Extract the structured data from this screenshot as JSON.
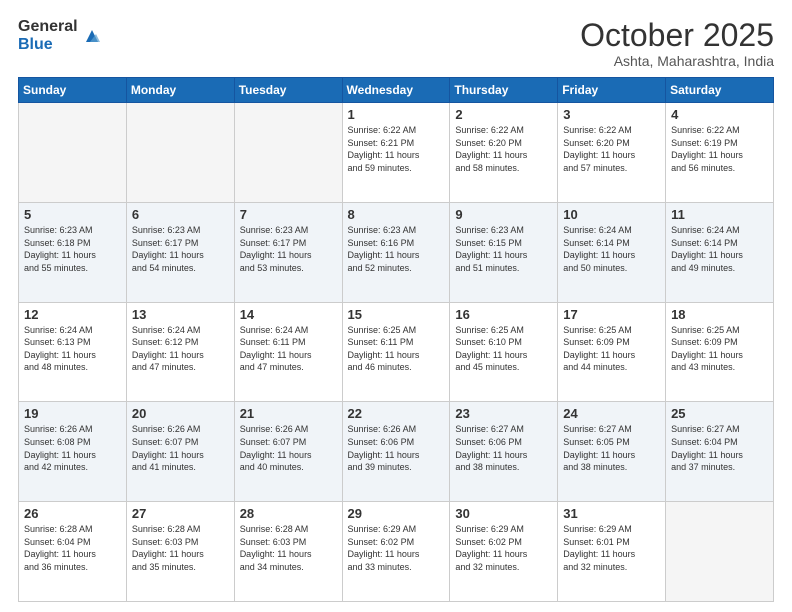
{
  "logo": {
    "general": "General",
    "blue": "Blue"
  },
  "header": {
    "month": "October 2025",
    "location": "Ashta, Maharashtra, India"
  },
  "weekdays": [
    "Sunday",
    "Monday",
    "Tuesday",
    "Wednesday",
    "Thursday",
    "Friday",
    "Saturday"
  ],
  "weeks": [
    [
      {
        "day": "",
        "info": ""
      },
      {
        "day": "",
        "info": ""
      },
      {
        "day": "",
        "info": ""
      },
      {
        "day": "1",
        "info": "Sunrise: 6:22 AM\nSunset: 6:21 PM\nDaylight: 11 hours\nand 59 minutes."
      },
      {
        "day": "2",
        "info": "Sunrise: 6:22 AM\nSunset: 6:20 PM\nDaylight: 11 hours\nand 58 minutes."
      },
      {
        "day": "3",
        "info": "Sunrise: 6:22 AM\nSunset: 6:20 PM\nDaylight: 11 hours\nand 57 minutes."
      },
      {
        "day": "4",
        "info": "Sunrise: 6:22 AM\nSunset: 6:19 PM\nDaylight: 11 hours\nand 56 minutes."
      }
    ],
    [
      {
        "day": "5",
        "info": "Sunrise: 6:23 AM\nSunset: 6:18 PM\nDaylight: 11 hours\nand 55 minutes."
      },
      {
        "day": "6",
        "info": "Sunrise: 6:23 AM\nSunset: 6:17 PM\nDaylight: 11 hours\nand 54 minutes."
      },
      {
        "day": "7",
        "info": "Sunrise: 6:23 AM\nSunset: 6:17 PM\nDaylight: 11 hours\nand 53 minutes."
      },
      {
        "day": "8",
        "info": "Sunrise: 6:23 AM\nSunset: 6:16 PM\nDaylight: 11 hours\nand 52 minutes."
      },
      {
        "day": "9",
        "info": "Sunrise: 6:23 AM\nSunset: 6:15 PM\nDaylight: 11 hours\nand 51 minutes."
      },
      {
        "day": "10",
        "info": "Sunrise: 6:24 AM\nSunset: 6:14 PM\nDaylight: 11 hours\nand 50 minutes."
      },
      {
        "day": "11",
        "info": "Sunrise: 6:24 AM\nSunset: 6:14 PM\nDaylight: 11 hours\nand 49 minutes."
      }
    ],
    [
      {
        "day": "12",
        "info": "Sunrise: 6:24 AM\nSunset: 6:13 PM\nDaylight: 11 hours\nand 48 minutes."
      },
      {
        "day": "13",
        "info": "Sunrise: 6:24 AM\nSunset: 6:12 PM\nDaylight: 11 hours\nand 47 minutes."
      },
      {
        "day": "14",
        "info": "Sunrise: 6:24 AM\nSunset: 6:11 PM\nDaylight: 11 hours\nand 47 minutes."
      },
      {
        "day": "15",
        "info": "Sunrise: 6:25 AM\nSunset: 6:11 PM\nDaylight: 11 hours\nand 46 minutes."
      },
      {
        "day": "16",
        "info": "Sunrise: 6:25 AM\nSunset: 6:10 PM\nDaylight: 11 hours\nand 45 minutes."
      },
      {
        "day": "17",
        "info": "Sunrise: 6:25 AM\nSunset: 6:09 PM\nDaylight: 11 hours\nand 44 minutes."
      },
      {
        "day": "18",
        "info": "Sunrise: 6:25 AM\nSunset: 6:09 PM\nDaylight: 11 hours\nand 43 minutes."
      }
    ],
    [
      {
        "day": "19",
        "info": "Sunrise: 6:26 AM\nSunset: 6:08 PM\nDaylight: 11 hours\nand 42 minutes."
      },
      {
        "day": "20",
        "info": "Sunrise: 6:26 AM\nSunset: 6:07 PM\nDaylight: 11 hours\nand 41 minutes."
      },
      {
        "day": "21",
        "info": "Sunrise: 6:26 AM\nSunset: 6:07 PM\nDaylight: 11 hours\nand 40 minutes."
      },
      {
        "day": "22",
        "info": "Sunrise: 6:26 AM\nSunset: 6:06 PM\nDaylight: 11 hours\nand 39 minutes."
      },
      {
        "day": "23",
        "info": "Sunrise: 6:27 AM\nSunset: 6:06 PM\nDaylight: 11 hours\nand 38 minutes."
      },
      {
        "day": "24",
        "info": "Sunrise: 6:27 AM\nSunset: 6:05 PM\nDaylight: 11 hours\nand 38 minutes."
      },
      {
        "day": "25",
        "info": "Sunrise: 6:27 AM\nSunset: 6:04 PM\nDaylight: 11 hours\nand 37 minutes."
      }
    ],
    [
      {
        "day": "26",
        "info": "Sunrise: 6:28 AM\nSunset: 6:04 PM\nDaylight: 11 hours\nand 36 minutes."
      },
      {
        "day": "27",
        "info": "Sunrise: 6:28 AM\nSunset: 6:03 PM\nDaylight: 11 hours\nand 35 minutes."
      },
      {
        "day": "28",
        "info": "Sunrise: 6:28 AM\nSunset: 6:03 PM\nDaylight: 11 hours\nand 34 minutes."
      },
      {
        "day": "29",
        "info": "Sunrise: 6:29 AM\nSunset: 6:02 PM\nDaylight: 11 hours\nand 33 minutes."
      },
      {
        "day": "30",
        "info": "Sunrise: 6:29 AM\nSunset: 6:02 PM\nDaylight: 11 hours\nand 32 minutes."
      },
      {
        "day": "31",
        "info": "Sunrise: 6:29 AM\nSunset: 6:01 PM\nDaylight: 11 hours\nand 32 minutes."
      },
      {
        "day": "",
        "info": ""
      }
    ]
  ]
}
